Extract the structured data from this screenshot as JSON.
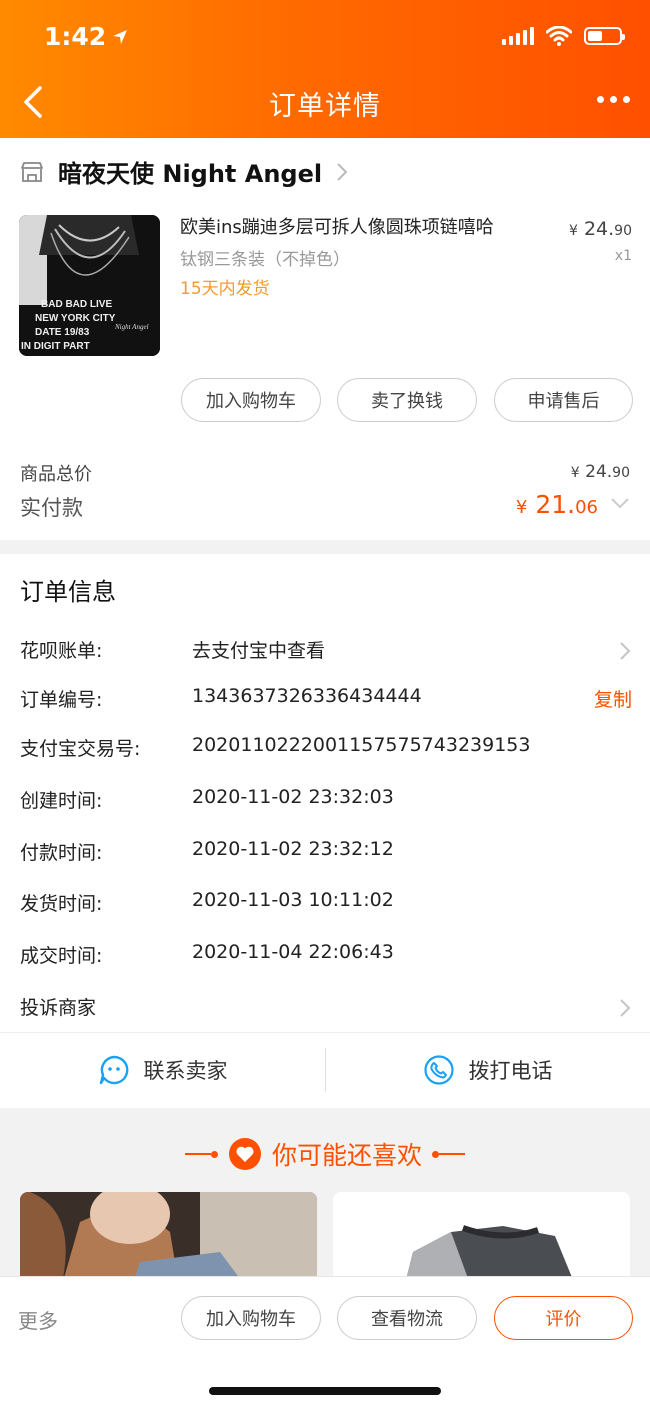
{
  "status_bar": {
    "time": "1:42"
  },
  "header": {
    "title": "订单详情"
  },
  "shop": {
    "name": "暗夜天使 Night Angel"
  },
  "product": {
    "title": "欧美ins蹦迪多层可拆人像圆珠项链嘻哈",
    "spec": "钛钢三条装（不掉色）",
    "shipping": "15天内发货",
    "price_symbol": "¥",
    "price_int": "24.",
    "price_dec": "90",
    "quantity": "x1",
    "thumb_text": [
      "BAD BAD LIVE",
      "NEW YORK CITY",
      "DATE 19/83",
      "IN DIGIT PART",
      "Night Angel"
    ]
  },
  "item_actions": {
    "add_cart": "加入购物车",
    "sell": "卖了换钱",
    "after_sale": "申请售后"
  },
  "totals": {
    "total_label": "商品总价",
    "total_symbol": "¥",
    "total_int": "24.",
    "total_dec": "90",
    "paid_label": "实付款",
    "paid_symbol": "¥",
    "paid_int": "21.",
    "paid_dec": "06"
  },
  "order_info": {
    "title": "订单信息",
    "rows": [
      {
        "key": "花呗账单:",
        "value": "去支付宝中查看"
      },
      {
        "key": "订单编号:",
        "value": "1343637326336434444",
        "action": "复制"
      },
      {
        "key": "支付宝交易号:",
        "value": "2020110222001157575743239153"
      },
      {
        "key": "创建时间:",
        "value": "2020-11-02 23:32:03"
      },
      {
        "key": "付款时间:",
        "value": "2020-11-02 23:32:12"
      },
      {
        "key": "发货时间:",
        "value": "2020-11-03 10:11:02"
      },
      {
        "key": "成交时间:",
        "value": "2020-11-04 22:06:43"
      },
      {
        "key": "投诉商家",
        "value": ""
      }
    ]
  },
  "contact": {
    "seller": "联系卖家",
    "phone": "拨打电话"
  },
  "recommend": {
    "title": "你可能还喜欢"
  },
  "bottom_bar": {
    "more": "更多",
    "add_cart": "加入购物车",
    "logistics": "查看物流",
    "review": "评价"
  },
  "colors": {
    "accent": "#ff5000",
    "header_start": "#ff8a00",
    "shipping": "#f39a2a"
  }
}
